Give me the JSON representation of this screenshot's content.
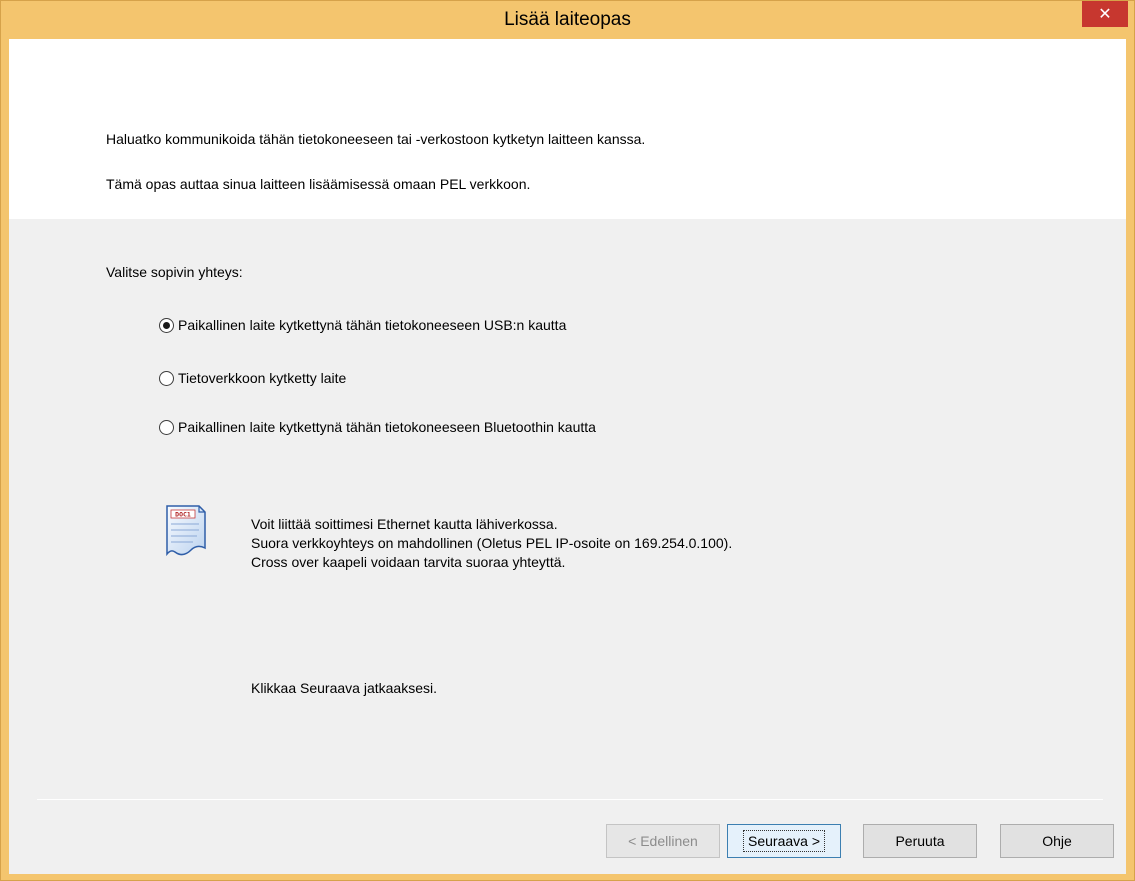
{
  "window": {
    "title": "Lisää laiteopas",
    "close_glyph": "✕"
  },
  "intro": {
    "line1": "Haluatko kommunikoida tähän tietokoneeseen tai -verkostoon kytketyn laitteen kanssa.",
    "line2": "Tämä opas auttaa sinua laitteen lisäämisessä omaan PEL verkkoon."
  },
  "connection": {
    "prompt": "Valitse sopivin yhteys:",
    "options": [
      {
        "label": "Paikallinen laite kytkettynä tähän tietokoneeseen USB:n kautta",
        "selected": true
      },
      {
        "label": "Tietoverkkoon kytketty laite",
        "selected": false
      },
      {
        "label": "Paikallinen laite kytkettynä tähän tietokoneeseen Bluetoothin kautta",
        "selected": false
      }
    ]
  },
  "info": {
    "icon": "document-icon",
    "icon_text": "DOC1",
    "lines": [
      "Voit liittää soittimesi Ethernet kautta lähiverkossa.",
      "Suora verkkoyhteys on mahdollinen (Oletus PEL IP-osoite on 169.254.0.100).",
      "Cross over kaapeli voidaan tarvita suoraa yhteyttä."
    ],
    "instruction": "Klikkaa Seuraava jatkaaksesi."
  },
  "buttons": {
    "back": "< Edellinen",
    "next": "Seuraava >",
    "cancel": "Peruuta",
    "help": "Ohje"
  },
  "colors": {
    "titlebar": "#f4c56e",
    "close": "#c7372f",
    "dialog_bg": "#f0f0f0"
  }
}
